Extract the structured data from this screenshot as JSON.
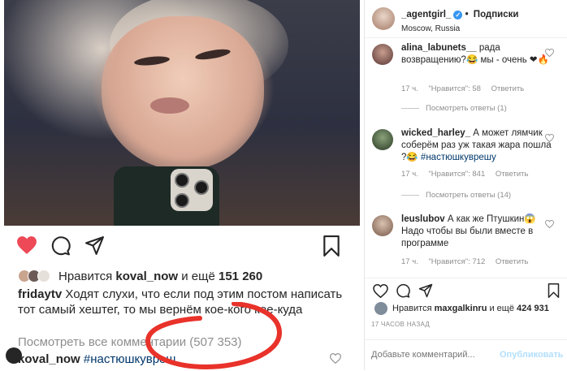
{
  "post_mobile": {
    "likes": {
      "prefix": "Нравится",
      "user": "koval_now",
      "middle": "и ещё",
      "count": "151 260"
    },
    "caption": {
      "user": "fridaytv",
      "text": "Ходят слухи, что если под этим постом написать тот самый хештег, то мы вернём кое-кого кое-куда"
    },
    "view_all_comments": "Посмотреть все комментарии (507 353)",
    "bottom_comment": {
      "user": "koval_now",
      "hashtag": "#настюшкувреш"
    },
    "colors": {
      "heart": "#ed4956",
      "annotation_circle": "#e8322a"
    }
  },
  "panel": {
    "header": {
      "username": "_agentgirl_",
      "dot": "•",
      "follow": "Подписки",
      "location": "Moscow, Russia"
    },
    "comments": [
      {
        "user": "alina_labunets__",
        "text": "рада возвращению?😂 мы - очень ❤🔥",
        "time": "17 ч.",
        "likes": "\"Нравится\": 58",
        "reply": "Ответить",
        "replies": "Посмотреть ответы (1)"
      },
      {
        "user": "wicked_harley_",
        "text": "А может лямчик соберём раз уж такая жара пошла ?😂 ",
        "hashtag": "#настюшкуврешу",
        "time": "17 ч.",
        "likes": "\"Нравится\": 841",
        "reply": "Ответить",
        "replies": "Посмотреть ответы (14)"
      },
      {
        "user": "leuslubov",
        "text": "А как же Птушкин😱 Надо чтобы вы были вместе в программе",
        "time": "17 ч.",
        "likes": "\"Нравится\": 712",
        "reply": "Ответить"
      }
    ],
    "likes": {
      "prefix": "Нравится",
      "user": "maxgalkinru",
      "middle": "и ещё",
      "count": "424 931"
    },
    "timestamp": "17 ЧАСОВ НАЗАД",
    "add_comment_placeholder": "Добавьте комментарий...",
    "publish": "Опубликовать"
  }
}
